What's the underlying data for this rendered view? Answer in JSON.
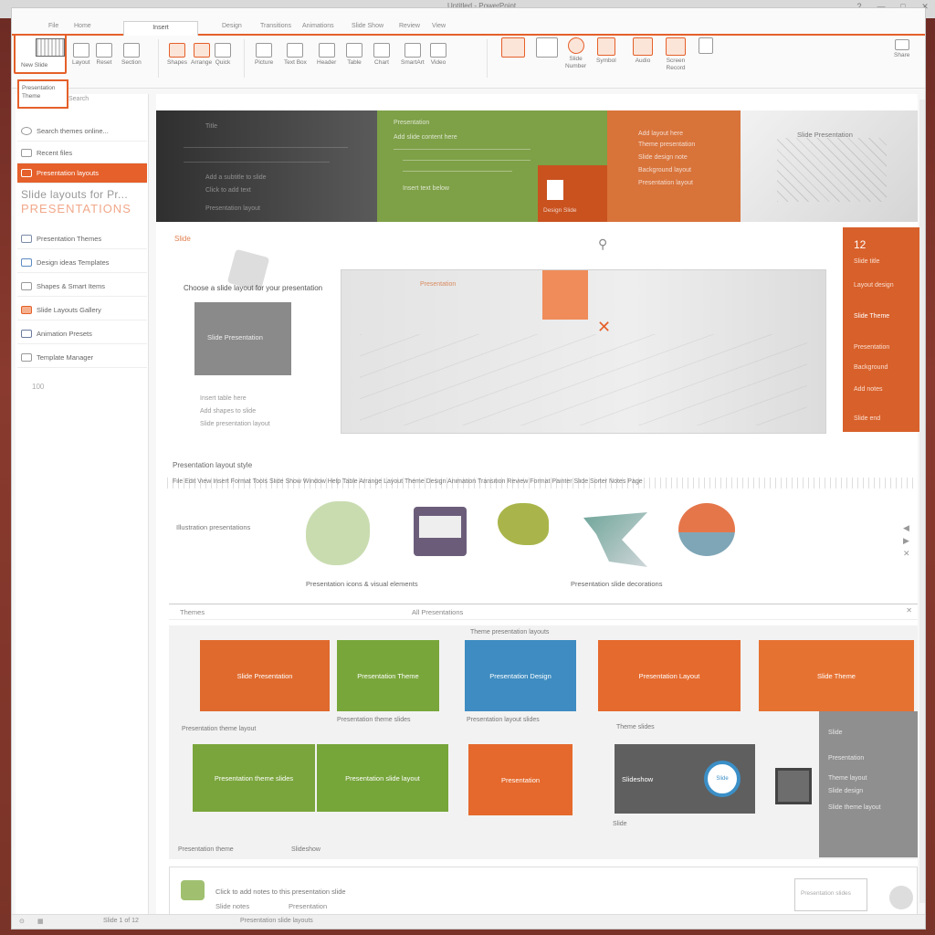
{
  "window": {
    "title": "Untitled - PowerPoint",
    "controls": [
      "?",
      "—",
      "□",
      "✕"
    ]
  },
  "ribbon": {
    "tabs": [
      "File",
      "Home",
      "Insert",
      "Design",
      "Transitions",
      "Animations",
      "Slide Show",
      "Review",
      "View"
    ],
    "active_tab": "Insert",
    "new_slide_label": "New Slide",
    "groups": [
      {
        "label": "Layout"
      },
      {
        "label": "Reset"
      },
      {
        "label": "Section"
      },
      {
        "label": "Shapes"
      },
      {
        "label": "Arrange"
      },
      {
        "label": "Quick"
      },
      {
        "label": "Picture"
      },
      {
        "label": "Text Box"
      },
      {
        "label": "Header"
      },
      {
        "label": "Table"
      },
      {
        "label": "Chart"
      },
      {
        "label": "SmartArt"
      },
      {
        "label": "Video"
      }
    ],
    "right_groups": [
      {
        "label": "Slide\nNumber"
      },
      {
        "label": "Symbol"
      },
      {
        "label": "Audio"
      },
      {
        "label": "Screen\nRecord"
      },
      {
        "label": "Share"
      }
    ]
  },
  "left_pane": {
    "tooltip": "Presentation Theme",
    "search": "Search",
    "items": [
      {
        "label": "Search themes online...",
        "active": false
      },
      {
        "label": "Recent files",
        "active": false
      },
      {
        "label": "Presentation layouts",
        "active": true
      }
    ],
    "big_text": "Slide layouts for Pr...",
    "big_text2": "PRESENTATIONS",
    "list": [
      "Presentation Themes",
      "Design ideas Templates",
      "Shapes & Smart Items",
      "Slide Layouts Gallery",
      "Animation Presets",
      "Template Manager"
    ],
    "footer_num": "100"
  },
  "banner": {
    "dark": {
      "title": "Title",
      "lines": [
        "Add a subtitle to slide",
        "Click to add text",
        "Presentation layout"
      ]
    },
    "green": {
      "title": "Presentation",
      "subtitle": "Add slide content here",
      "line2": "Insert text below"
    },
    "card_label": "Design Slide",
    "orange": {
      "lines": [
        "Add layout here",
        "Theme presentation",
        "Slide design note",
        "Background layout",
        "Presentation layout"
      ]
    },
    "photo": {
      "title": "Slide Presentation"
    }
  },
  "middle": {
    "label": "Slide",
    "caption": "Choose a slide layout for your presentation",
    "grey_card": "Slide Presentation",
    "small": [
      "Insert table here",
      "Add shapes to slide",
      "Slide presentation layout"
    ],
    "canvas_title": "Presentation",
    "right_panel": {
      "big": "12",
      "lines": [
        "Slide title",
        "Layout design",
        "Slide Theme",
        "Presentation",
        "Background",
        "Add notes",
        "Slide end"
      ]
    }
  },
  "section": {
    "title": "Presentation layout style",
    "items": "File  Edit  View  Insert  Format  Tools  Slide Show  Window  Help  Table  Arrange  Layout  Theme  Design  Animation  Transition  Review  Format Painter  Slide Sorter  Notes Page"
  },
  "illustrations": {
    "label": "Illustration presentations",
    "caption1": "Presentation icons & visual elements",
    "caption2": "Presentation slide decorations",
    "side": [
      "◀",
      "▶",
      "✕"
    ]
  },
  "gallery": {
    "header_left": "Themes",
    "header_center": "All Presentations",
    "header_right": "✕",
    "top_caption": "Theme presentation layouts",
    "cards_row1": [
      {
        "label": "Slide Presentation",
        "color": "#e06a2d"
      },
      {
        "label": "Presentation Theme",
        "color": "#79a63b"
      },
      {
        "label": "Presentation Design",
        "color": "#3e8cc1"
      },
      {
        "label": "Presentation Layout",
        "color": "#e56a2e"
      },
      {
        "label": "Slide Theme",
        "color": "#e67232"
      }
    ],
    "captions_row1": [
      "Presentation theme layout",
      "Presentation theme slides",
      "Presentation layout slides",
      "Theme slides"
    ],
    "cards_row2": [
      {
        "label": "Presentation theme slides",
        "color": "#7aa53c"
      },
      {
        "label": "Presentation slide layout",
        "color": "#76a53a"
      },
      {
        "label": "Presentation",
        "color": "#e5692c"
      },
      {
        "label": "Slideshow",
        "color": "#5f5f5f"
      }
    ],
    "badge": "Slide",
    "grey_lines": [
      "Slide",
      "Presentation",
      "Theme layout",
      "Slide design",
      "Slide theme layout"
    ],
    "bottom_caps": [
      "Presentation theme",
      "Slideshow"
    ],
    "caption_small": "Slide"
  },
  "notes": {
    "line1": "Click to add notes to this presentation slide",
    "line2": "Slide notes",
    "line3": "Presentation",
    "box": "Presentation slides"
  },
  "status": {
    "left": "Slide 1 of 12",
    "center": "Presentation slide layouts"
  }
}
